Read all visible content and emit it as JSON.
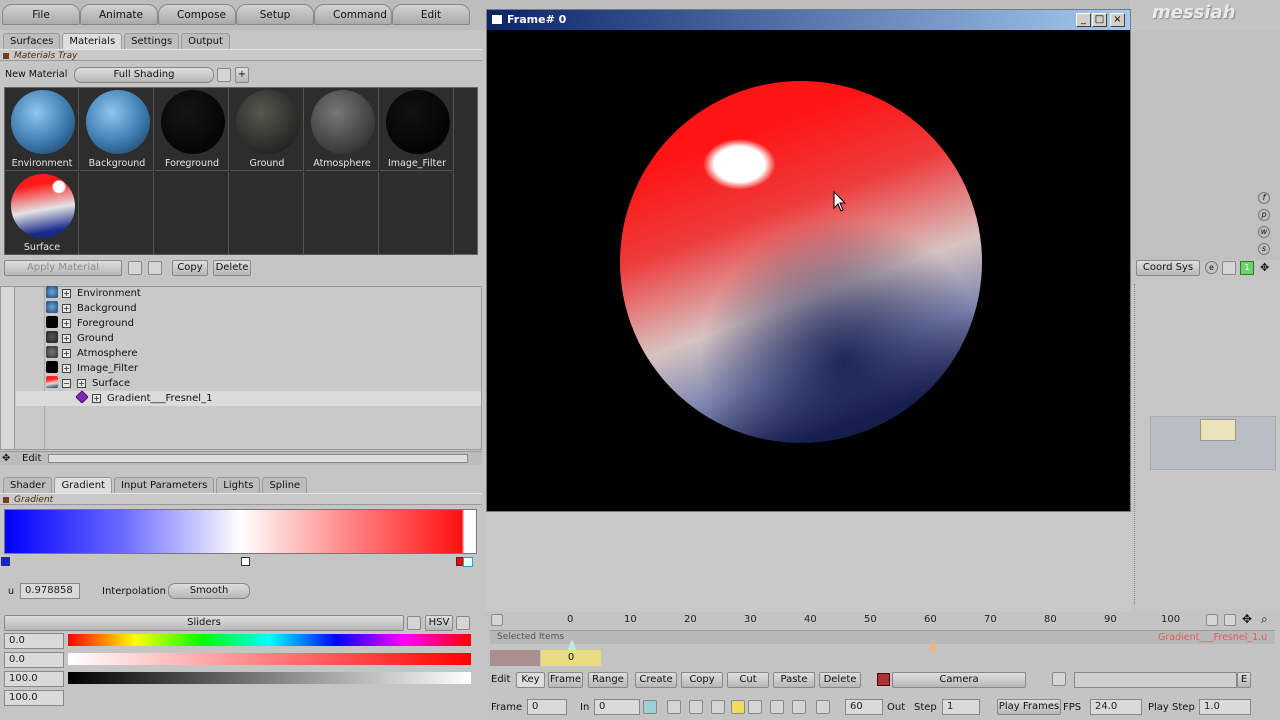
{
  "menu": {
    "items": [
      "File",
      "Animate",
      "Compose",
      "Setup",
      "Command",
      "Edit"
    ],
    "brand": "messiah"
  },
  "left_tabs": [
    "Surfaces",
    "Materials",
    "Settings",
    "Output"
  ],
  "materials_tray": {
    "title": "Materials Tray",
    "new_material_label": "New Material",
    "shading_button": "Full Shading",
    "plus": "+",
    "swatches": [
      {
        "label": "Environment"
      },
      {
        "label": "Background"
      },
      {
        "label": "Foreground"
      },
      {
        "label": "Ground"
      },
      {
        "label": "Atmosphere"
      },
      {
        "label": "Image_Filter"
      },
      {
        "label": "Surface"
      }
    ],
    "apply_material": "Apply Material",
    "copy": "Copy",
    "delete": "Delete"
  },
  "tree": {
    "items": [
      {
        "label": "Environment"
      },
      {
        "label": "Background"
      },
      {
        "label": "Foreground"
      },
      {
        "label": "Ground"
      },
      {
        "label": "Atmosphere"
      },
      {
        "label": "Image_Filter"
      },
      {
        "label": "Surface"
      },
      {
        "label": "Gradient___Fresnel_1"
      }
    ],
    "edit": "Edit"
  },
  "shader_tabs": [
    "Shader",
    "Gradient",
    "Input Parameters",
    "Lights",
    "Spline"
  ],
  "gradient": {
    "title": "Gradient",
    "u_label": "u",
    "u_value": "0.978858",
    "interpolation_label": "Interpolation",
    "interpolation_value": "Smooth",
    "sliders_label": "Sliders",
    "color_mode": "HSV",
    "slider_values": [
      "0.0",
      "0.0",
      "100.0",
      "100.0"
    ]
  },
  "render_window": {
    "title": "Frame# 0",
    "minimize": "_",
    "maximize": "□",
    "close": "×"
  },
  "right_panel": {
    "coord_sys": "Coord Sys",
    "side_letters": [
      "f",
      "p",
      "w",
      "s"
    ],
    "coord_letter": "e",
    "coord_num": "1"
  },
  "timeline": {
    "ticks": [
      "0",
      "10",
      "20",
      "30",
      "40",
      "50",
      "60",
      "70",
      "80",
      "90",
      "100"
    ],
    "selected_items": "Selected Items",
    "channel": "Gradient___Fresnel_1.u",
    "current_frame_marker": "0"
  },
  "key_bar": {
    "edit": "Edit",
    "key": "Key",
    "frame": "Frame",
    "range": "Range",
    "create": "Create",
    "copy": "Copy",
    "cut": "Cut",
    "paste": "Paste",
    "delete": "Delete",
    "camera": "Camera",
    "e": "E"
  },
  "transport": {
    "frame_label": "Frame",
    "frame_value": "0",
    "in_label": "In",
    "in_value": "0",
    "out_value": "60",
    "out_label": "Out",
    "step_label": "Step",
    "step_value": "1",
    "play_frames": "Play Frames",
    "fps_label": "FPS",
    "fps_value": "24.0",
    "play_step_label": "Play Step",
    "play_step_value": "1.0"
  }
}
